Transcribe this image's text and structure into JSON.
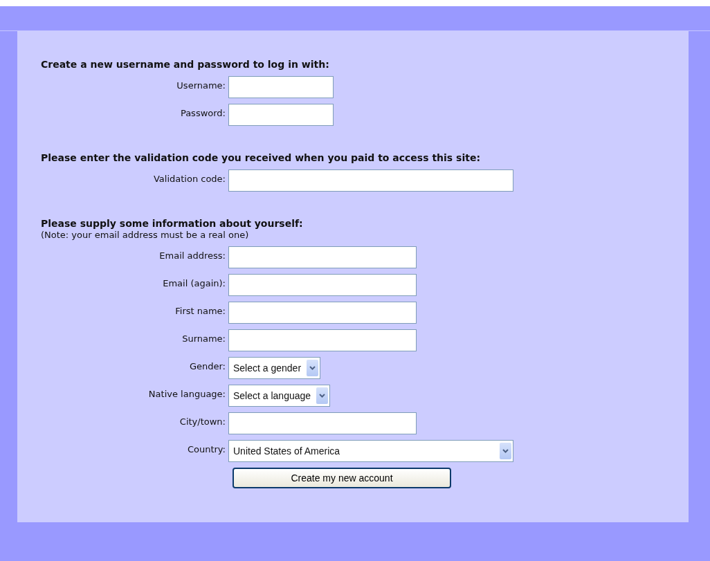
{
  "sections": [
    {
      "heading": "Create a new username and password to log in with:",
      "fields": [
        {
          "label": "Username:",
          "kind": "text"
        },
        {
          "label": "Password:",
          "kind": "text"
        }
      ]
    },
    {
      "heading": "Please enter the validation code you received when you paid to access this site:",
      "fields": [
        {
          "label": "Validation code:",
          "kind": "text"
        }
      ]
    },
    {
      "heading": "Please supply some information about yourself:",
      "note": "(Note: your email address must be a real one)",
      "fields": [
        {
          "label": "Email address:",
          "kind": "text"
        },
        {
          "label": "Email (again):",
          "kind": "text"
        },
        {
          "label": "First name:",
          "kind": "text"
        },
        {
          "label": "Surname:",
          "kind": "text"
        },
        {
          "label": "Gender:",
          "kind": "select",
          "value": "Select a gender"
        },
        {
          "label": "Native language:",
          "kind": "select",
          "value": "Select a language"
        },
        {
          "label": "City/town:",
          "kind": "text"
        },
        {
          "label": "Country:",
          "kind": "select",
          "value": "United States of America"
        }
      ]
    }
  ],
  "submit": {
    "label": "Create my new account"
  }
}
